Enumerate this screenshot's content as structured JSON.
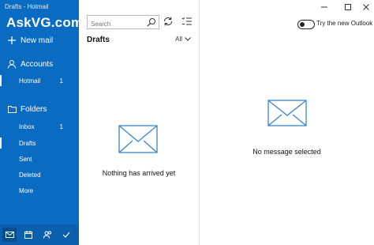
{
  "window": {
    "title": "Drafts - Hotmail"
  },
  "brand": "AskVG.com",
  "sidebar": {
    "new_mail": "New mail",
    "accounts_label": "Accounts",
    "account": {
      "name": "Hotmail",
      "count": "1"
    },
    "folders_label": "Folders",
    "folders": [
      {
        "label": "Inbox",
        "count": "1"
      },
      {
        "label": "Drafts",
        "count": ""
      },
      {
        "label": "Sent",
        "count": ""
      },
      {
        "label": "Deleted",
        "count": ""
      },
      {
        "label": "More",
        "count": ""
      }
    ],
    "selected_folder": "Drafts"
  },
  "search": {
    "placeholder": "Search"
  },
  "list": {
    "folder_title": "Drafts",
    "filter": "All",
    "empty_text": "Nothing has arrived yet"
  },
  "reading": {
    "toggle_label": "Try the new Outlook",
    "toggle_on": false,
    "empty_text": "No message selected"
  },
  "colors": {
    "sidebar": "#0a6bc2",
    "envelope": "#3a86c8"
  }
}
